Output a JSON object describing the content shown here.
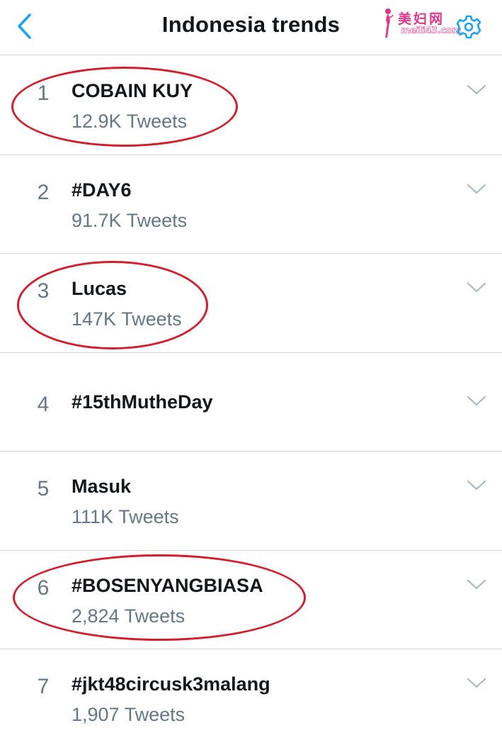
{
  "header": {
    "title": "Indonesia trends",
    "back_icon": "chevron-left-icon",
    "settings_icon": "gear-icon",
    "accent_color": "#1da1f2"
  },
  "watermark": {
    "site_name": "美妇网",
    "site_url": "meili43.com",
    "color": "#e0368a"
  },
  "trends": [
    {
      "rank": "1",
      "name": "COBAIN KUY",
      "count": "12.9K Tweets",
      "circled": true
    },
    {
      "rank": "2",
      "name": "#DAY6",
      "count": "91.7K Tweets",
      "circled": false
    },
    {
      "rank": "3",
      "name": "Lucas",
      "count": "147K Tweets",
      "circled": true
    },
    {
      "rank": "4",
      "name": "#15thMutheDay",
      "count": "",
      "circled": false
    },
    {
      "rank": "5",
      "name": "Masuk",
      "count": "111K Tweets",
      "circled": false
    },
    {
      "rank": "6",
      "name": "#BOSENYANGBIASA",
      "count": "2,824 Tweets",
      "circled": true
    },
    {
      "rank": "7",
      "name": "#jkt48circusk3malang",
      "count": "1,907 Tweets",
      "circled": false
    }
  ],
  "colors": {
    "text_primary": "#14171a",
    "text_secondary": "#657786",
    "divider": "#d6d6d6",
    "annotation": "#d01f2e"
  }
}
